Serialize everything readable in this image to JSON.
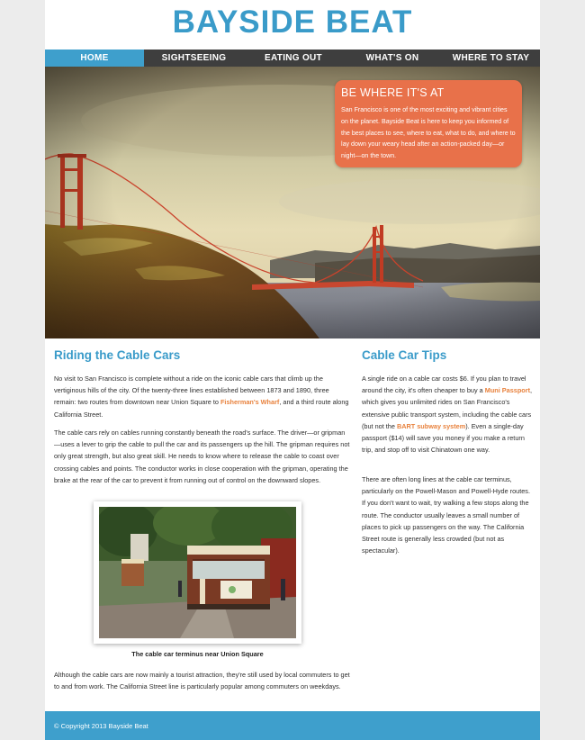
{
  "site": {
    "title": "BAYSIDE BEAT"
  },
  "nav": {
    "items": [
      {
        "label": "HOME",
        "active": true
      },
      {
        "label": "SIGHTSEEING",
        "active": false
      },
      {
        "label": "EATING OUT",
        "active": false
      },
      {
        "label": "WHAT'S ON",
        "active": false
      },
      {
        "label": "WHERE TO STAY",
        "active": false
      }
    ]
  },
  "hero": {
    "callout_title": "BE WHERE IT'S AT",
    "callout_text": "San Francisco is one of the most exciting and vibrant cities on the planet. Bayside Beat is here to keep you informed of the best places to see, where to eat, what to do, and where to lay down your weary head after an action-packed day—or night—on the town."
  },
  "main": {
    "heading": "Riding the Cable Cars",
    "p1_before": "No visit to San Francisco is complete without a ride on the iconic cable cars that climb up the vertiginous hills of the city. Of the twenty-three lines established between 1873 and 1890, three remain: two routes from downtown near Union Square to ",
    "p1_link": "Fisherman's Wharf",
    "p1_after": ", and a third route along California Street.",
    "p2": "The cable cars rely on cables running constantly beneath the road's surface. The driver—or gripman—uses a lever to grip the cable to pull the car and its passengers up the hill. The gripman requires not only great strength, but also great skill. He needs to know where to release the cable to coast over crossing cables and points. The conductor works in close cooperation with the gripman, operating the brake at the rear of the car to prevent it from running out of control on the downward slopes.",
    "figure_caption": "The cable car terminus near Union Square",
    "p3": "Although the cable cars are now mainly a tourist attraction, they're still used by local commuters to get to and from work. The California Street line is particularly popular among commuters on weekdays."
  },
  "aside": {
    "heading": "Cable Car Tips",
    "p1_a": "A single ride on a cable car costs $6. If you plan to travel around the city, it's often cheaper to buy a ",
    "p1_link1": "Muni Passport",
    "p1_b": ", which gives you unlimited rides on San Francisco's extensive public transport system, including the cable cars (but not the ",
    "p1_link2": "BART subway system",
    "p1_c": "). Even a single-day passport ($14) will save you money if you make a return trip, and stop off to visit Chinatown one way.",
    "p2": "There are often long lines at the cable car terminus, particularly on the Powell-Mason and Powell-Hyde routes. If you don't want to wait, try walking a few stops along the route. The conductor usually leaves a small number of places to pick up passengers on the way. The California Street route is generally less crowded (but not as spectacular)."
  },
  "footer": {
    "copyright": "© Copyright 2013 Bayside Beat"
  },
  "colors": {
    "accent_blue": "#3e9fcc",
    "callout_orange": "#e8714a",
    "link_orange": "#e8813c",
    "nav_dark": "#3e3e3e"
  }
}
